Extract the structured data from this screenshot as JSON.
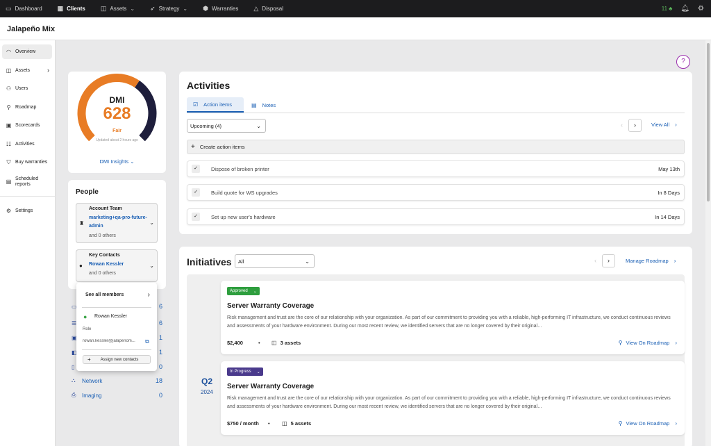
{
  "topnav": {
    "items": [
      {
        "label": "Dashboard",
        "icon": "dashboard-icon"
      },
      {
        "label": "Clients",
        "icon": "clients-icon"
      },
      {
        "label": "Assets",
        "icon": "assets-icon"
      },
      {
        "label": "Strategy",
        "icon": "rocket-icon"
      },
      {
        "label": "Warranties",
        "icon": "shield-icon"
      },
      {
        "label": "Disposal",
        "icon": "recycle-icon"
      }
    ],
    "active": "Clients",
    "notification_count": "11"
  },
  "header": {
    "title": "Jalapeño Mix"
  },
  "sidebar": {
    "items": [
      {
        "label": "Overview",
        "icon": "overview-icon"
      },
      {
        "label": "Assets",
        "icon": "assets-icon"
      },
      {
        "label": "Users",
        "icon": "users-icon"
      },
      {
        "label": "Roadmap",
        "icon": "roadmap-icon"
      },
      {
        "label": "Scorecards",
        "icon": "scorecards-icon"
      },
      {
        "label": "Activities",
        "icon": "activities-icon"
      },
      {
        "label": "Buy warranties",
        "icon": "cart-icon"
      },
      {
        "label": "Scheduled reports",
        "icon": "calendar-icon"
      },
      {
        "label": "Settings",
        "icon": "gear-icon"
      }
    ]
  },
  "dmi": {
    "label": "DMI",
    "score": "628",
    "rating": "Fair",
    "updated": "Updated about 2 hours ago",
    "insights_label": "DMI Insights",
    "gauge_fraction": 0.628,
    "colors": {
      "filled": "#e87c25",
      "remaining": "#1e1e3c"
    }
  },
  "people": {
    "title": "People",
    "account_team": {
      "heading": "Account Team",
      "name": "marketing+qa-pro-future-admin",
      "others": "and 0 others"
    },
    "key_contacts": {
      "heading": "Key Contacts",
      "name": "Rowan Kessler",
      "others": "and 0 others"
    }
  },
  "stats": [
    {
      "label": "Network",
      "value": "18",
      "icon": "network-icon"
    },
    {
      "label": "Imaging",
      "value": "0",
      "icon": "printer-icon"
    }
  ],
  "stats_partial_values": [
    "6",
    "6",
    "1",
    "1",
    "0"
  ],
  "popover": {
    "see_all": "See all members",
    "name": "Rowan Kessler",
    "role": "Role",
    "email": "rowan.kessler@jalapeñomix.com",
    "email_display": "rowan.kessler@jalapeñom...",
    "assign": "Assign new contacts"
  },
  "activities": {
    "title": "Activities",
    "tabs": [
      {
        "label": "Action items"
      },
      {
        "label": "Notes"
      }
    ],
    "filter": "Upcoming (4)",
    "view_all": "View All",
    "create": "Create action items",
    "items": [
      {
        "label": "Dispose of broken printer",
        "due": "May 13th"
      },
      {
        "label": "Build quote for WS upgrades",
        "due": "In 8 Days"
      },
      {
        "label": "Set up new user's hardware",
        "due": "In 14 Days"
      }
    ]
  },
  "initiatives": {
    "title": "Initiatives",
    "filter": "All",
    "manage": "Manage Roadmap",
    "quarter": "Q2",
    "year": "2024",
    "items": [
      {
        "status": "Approved",
        "status_color": "#2e9e3e",
        "title": "Server Warranty Coverage",
        "description": "Risk management and trust are the core of our relationship with your organization. As part of our commitment to providing you with a reliable, high-performing IT infrastructure, we conduct continuous reviews and assessments of your hardware environment. During our most recent review, we identified servers that are no longer covered by their original…",
        "cost": "$2,400",
        "assets": "3 assets",
        "roadmap": "View On Roadmap"
      },
      {
        "status": "In Progress",
        "status_color": "#4a3a8c",
        "title": "Server Warranty Coverage",
        "description": "Risk management and trust are the core of our relationship with your organization. As part of our commitment to providing you with a reliable, high-performing IT infrastructure, we conduct continuous reviews and assessments of your hardware environment. During our most recent review, we identified servers that are no longer covered by their original…",
        "cost": "$750 / month",
        "assets": "5 assets",
        "roadmap": "View On Roadmap"
      }
    ]
  }
}
